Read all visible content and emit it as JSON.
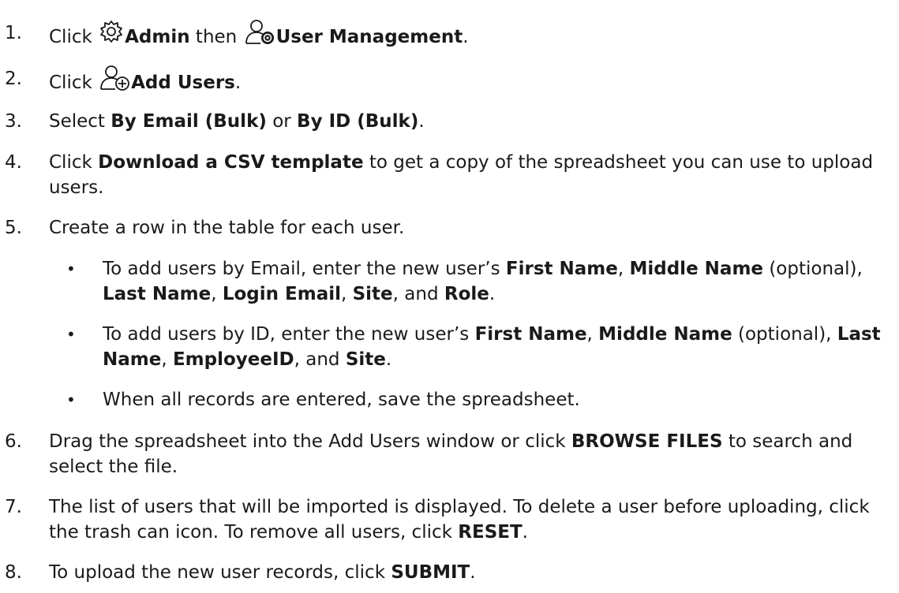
{
  "steps": [
    {
      "num": "1.",
      "parts": [
        "Click ",
        "Admin",
        " then ",
        "User Management",
        "."
      ]
    },
    {
      "num": "2.",
      "parts": [
        "Click ",
        "Add Users",
        "."
      ]
    },
    {
      "num": "3.",
      "parts": [
        "Select ",
        "By Email (Bulk)",
        " or ",
        "By ID (Bulk)",
        "."
      ]
    },
    {
      "num": "4.",
      "parts": [
        "Click ",
        "Download a CSV template",
        " to get a copy of the spreadsheet you can use to upload users."
      ]
    },
    {
      "num": "5.",
      "parts": [
        "Create a row in the table for each user."
      ]
    },
    {
      "num": "6.",
      "parts": [
        "Drag the spreadsheet into the Add Users window or click ",
        "BROWSE FILES",
        " to search and select the file."
      ]
    },
    {
      "num": "7.",
      "parts": [
        "The list of users that will be imported is displayed. To delete a user before uploading, click the trash can icon. To remove all users, click ",
        "RESET",
        "."
      ]
    },
    {
      "num": "8.",
      "parts": [
        "To upload the new user records, click ",
        "SUBMIT",
        "."
      ]
    }
  ],
  "bullets": [
    {
      "dot": "•",
      "parts": [
        "To add users by Email, enter the new user’s ",
        "First Name",
        ", ",
        "Middle Name",
        " (optional), ",
        "Last Name",
        ", ",
        "Login Email",
        ", ",
        "Site",
        ", and ",
        "Role",
        "."
      ]
    },
    {
      "dot": "•",
      "parts": [
        "To add users by ID, enter the new user’s ",
        "First Name",
        ", ",
        "Middle Name",
        " (optional), ",
        "Last Name",
        ", ",
        "EmployeeID",
        ", and ",
        "Site",
        "."
      ]
    },
    {
      "dot": "•",
      "parts": [
        "When all records are entered, save the spreadsheet."
      ]
    }
  ],
  "icons": {
    "admin": "gear-icon",
    "user_management": "user-gear-icon",
    "add_users": "user-add-icon"
  }
}
